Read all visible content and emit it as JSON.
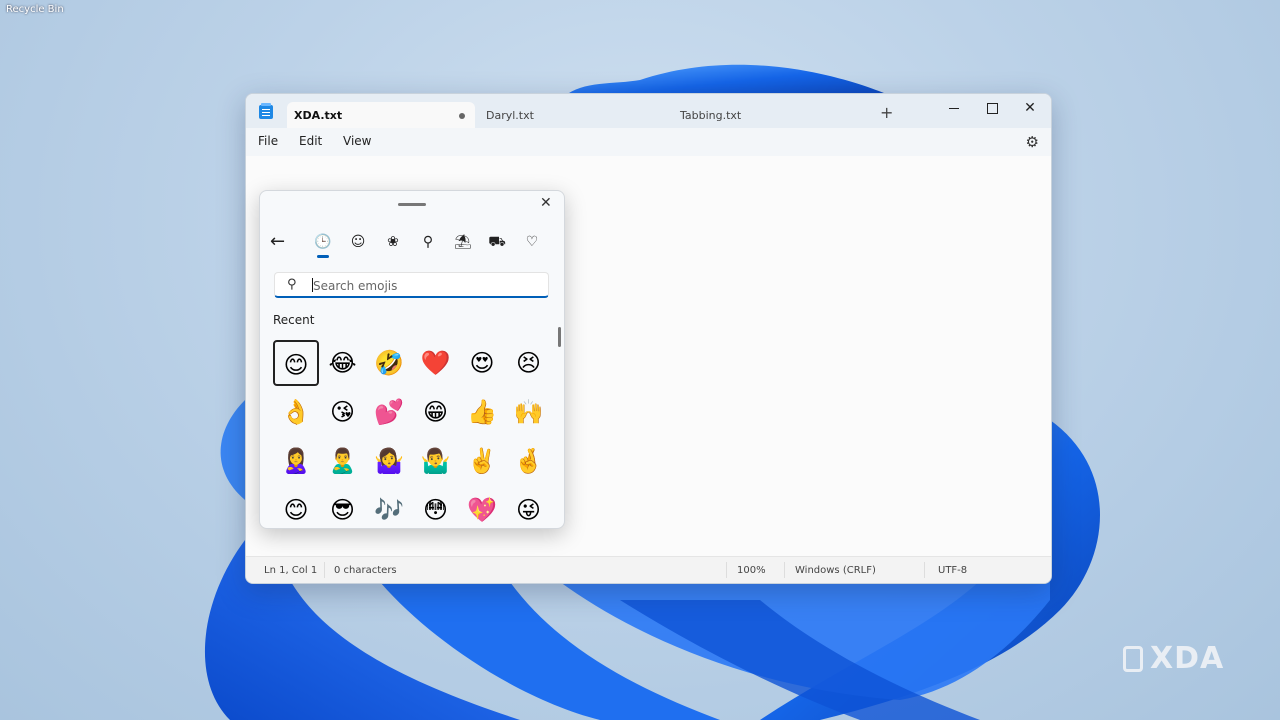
{
  "desktop": {
    "recycle_bin_label": "Recycle Bin",
    "watermark": "XDA"
  },
  "notepad": {
    "tabs": [
      {
        "label": "XDA.txt",
        "active": true,
        "unsaved_dot": true
      },
      {
        "label": "Daryl.txt",
        "active": false
      },
      {
        "label": "Tabbing.txt",
        "active": false
      }
    ],
    "new_tab_label": "+",
    "window_controls": {
      "minimize": "minimize",
      "maximize": "maximize",
      "close": "✕"
    },
    "menu": [
      "File",
      "Edit",
      "View"
    ],
    "settings_icon": "gear-icon",
    "status": {
      "position": "Ln 1, Col 1",
      "characters": "0 characters",
      "zoom": "100%",
      "line_ending": "Windows (CRLF)",
      "encoding": "UTF-8"
    }
  },
  "emoji_panel": {
    "close_label": "✕",
    "back_label": "←",
    "categories": [
      {
        "icon": "🕒",
        "name": "recent",
        "active": true
      },
      {
        "icon": "☺",
        "name": "smileys"
      },
      {
        "icon": "❀",
        "name": "people-animals"
      },
      {
        "icon": "⚲",
        "name": "food"
      },
      {
        "icon": "⛱",
        "name": "celebrations"
      },
      {
        "icon": "⛟",
        "name": "travel"
      },
      {
        "icon": "♡",
        "name": "symbols"
      }
    ],
    "search": {
      "placeholder": "Search emojis",
      "value": ""
    },
    "section_label": "Recent",
    "emojis": [
      [
        "😊",
        "😂",
        "🤣",
        "❤️",
        "😍",
        "😣"
      ],
      [
        "👌",
        "😘",
        "💕",
        "😁",
        "👍",
        "🙌"
      ],
      [
        "🙎‍♀️",
        "🙎‍♂️",
        "🤷‍♀️",
        "🤷‍♂️",
        "✌️",
        "🤞"
      ],
      [
        "😊",
        "😎",
        "🎶",
        "😳",
        "💖",
        "😜"
      ]
    ],
    "selected_index": 0
  }
}
